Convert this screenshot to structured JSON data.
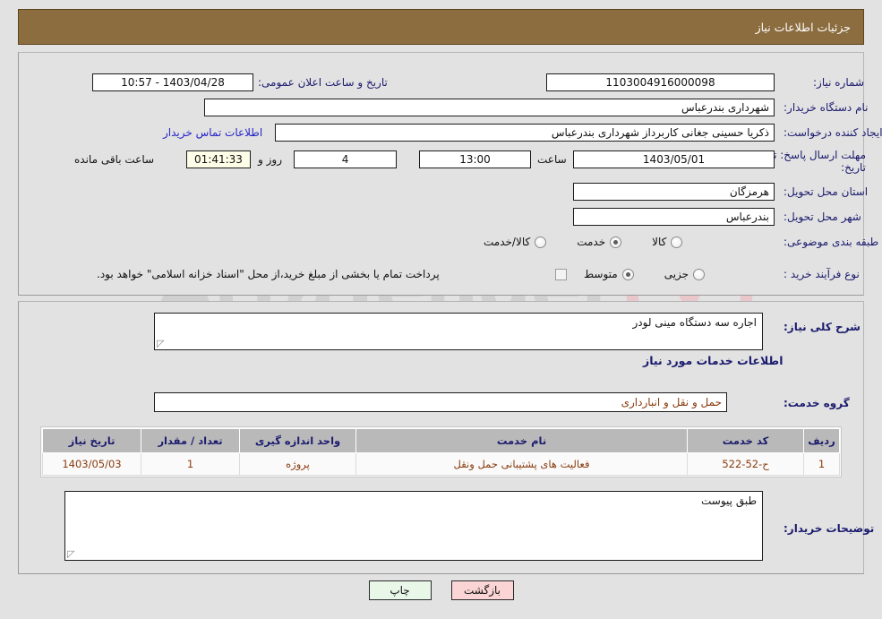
{
  "header": {
    "title": "جزئیات اطلاعات نیاز",
    "bg_color": "#8c6d3f"
  },
  "watermark": {
    "text": "ArtaTender",
    "shield_color": "#e8c9cd"
  },
  "form": {
    "need_number_label": "شماره نیاز:",
    "need_number_value": "1103004916000098",
    "buyer_org_label": "نام دستگاه خریدار:",
    "buyer_org_value": "شهرداری بندرعباس",
    "creator_label": "ایجاد کننده درخواست:",
    "creator_value": "ذکریا حسینی جغانی کاربرداز شهرداری بندرعباس",
    "contact_link": "اطلاعات تماس خریدار",
    "announce_label": "تاریخ و ساعت اعلان عمومی:",
    "announce_value": "1403/04/28 - 10:57",
    "deadline_label_line1": "مهلت ارسال پاسخ: تا",
    "deadline_label_line2": "تاریخ:",
    "deadline_date": "1403/05/01",
    "time_label": "ساعت",
    "deadline_time": "13:00",
    "days_value": "4",
    "days_label": "روز و",
    "countdown_value": "01:41:33",
    "remaining_label": "ساعت باقی مانده",
    "province_label": "استان محل تحویل:",
    "province_value": "هرمزگان",
    "city_label": "شهر محل تحویل:",
    "city_value": "بندرعباس",
    "category_label": "طبقه بندی موضوعی:",
    "category_options": [
      {
        "label": "کالا",
        "selected": false
      },
      {
        "label": "خدمت",
        "selected": true
      },
      {
        "label": "کالا/خدمت",
        "selected": false
      }
    ],
    "process_label": "نوع فرآیند خرید :",
    "process_options": [
      {
        "label": "جزیی",
        "selected": false
      },
      {
        "label": "متوسط",
        "selected": true
      }
    ],
    "treasury_checkbox_checked": false,
    "treasury_text": "پرداخت تمام یا بخشی از مبلغ خرید،از محل \"اسناد خزانه اسلامی\" خواهد بود."
  },
  "description": {
    "label": "شرح کلی نیاز:",
    "value": "اجاره سه دستگاه مینی لودر"
  },
  "services_section": {
    "heading": "اطلاعات خدمات مورد نیاز",
    "group_label": "گروه خدمت:",
    "group_value": "حمل و نقل و انبارداری"
  },
  "table": {
    "columns": [
      "ردیف",
      "کد خدمت",
      "نام خدمت",
      "واحد اندازه گیری",
      "تعداد / مقدار",
      "تاریخ نیاز"
    ],
    "rows": [
      {
        "radif": "1",
        "code": "ح-52-522",
        "name": "فعالیت های پشتیبانی حمل ونقل",
        "unit": "پروژه",
        "qty": "1",
        "date": "1403/05/03"
      }
    ]
  },
  "buyer_notes": {
    "label": "توضیحات خریدار:",
    "value": "طبق پیوست"
  },
  "buttons": {
    "print": "چاپ",
    "back": "بازگشت"
  }
}
